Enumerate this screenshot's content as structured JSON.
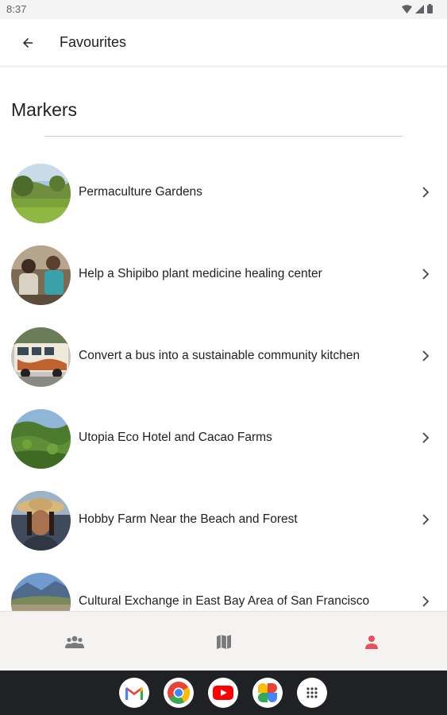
{
  "status_bar": {
    "time": "8:37",
    "icons": [
      "wifi-icon",
      "signal-icon",
      "battery-icon"
    ]
  },
  "app_bar": {
    "back_icon": "arrow-left-icon",
    "title": "Favourites"
  },
  "section": {
    "title": "Markers"
  },
  "markers": [
    {
      "label": "Permaculture Gardens",
      "thumbnail": "garden-photo"
    },
    {
      "label": "Help a Shipibo plant medicine healing center",
      "thumbnail": "people-photo"
    },
    {
      "label": "Convert a bus into a sustainable community kitchen",
      "thumbnail": "bus-photo"
    },
    {
      "label": "Utopia Eco Hotel and Cacao Farms",
      "thumbnail": "jungle-photo"
    },
    {
      "label": "Hobby Farm Near the Beach and Forest",
      "thumbnail": "portrait-photo"
    },
    {
      "label": "Cultural Exchange in East Bay Area of San Francisco",
      "thumbnail": "landscape-photo"
    }
  ],
  "bottom_nav": {
    "items": [
      {
        "icon": "people-icon",
        "active": false
      },
      {
        "icon": "map-icon",
        "active": false
      },
      {
        "icon": "person-icon",
        "active": true
      }
    ],
    "active_color": "#e8505b",
    "inactive_color": "#7a7a7a"
  },
  "dock": {
    "apps": [
      "gmail-icon",
      "chrome-icon",
      "youtube-icon",
      "photos-icon",
      "app-drawer-icon"
    ]
  }
}
